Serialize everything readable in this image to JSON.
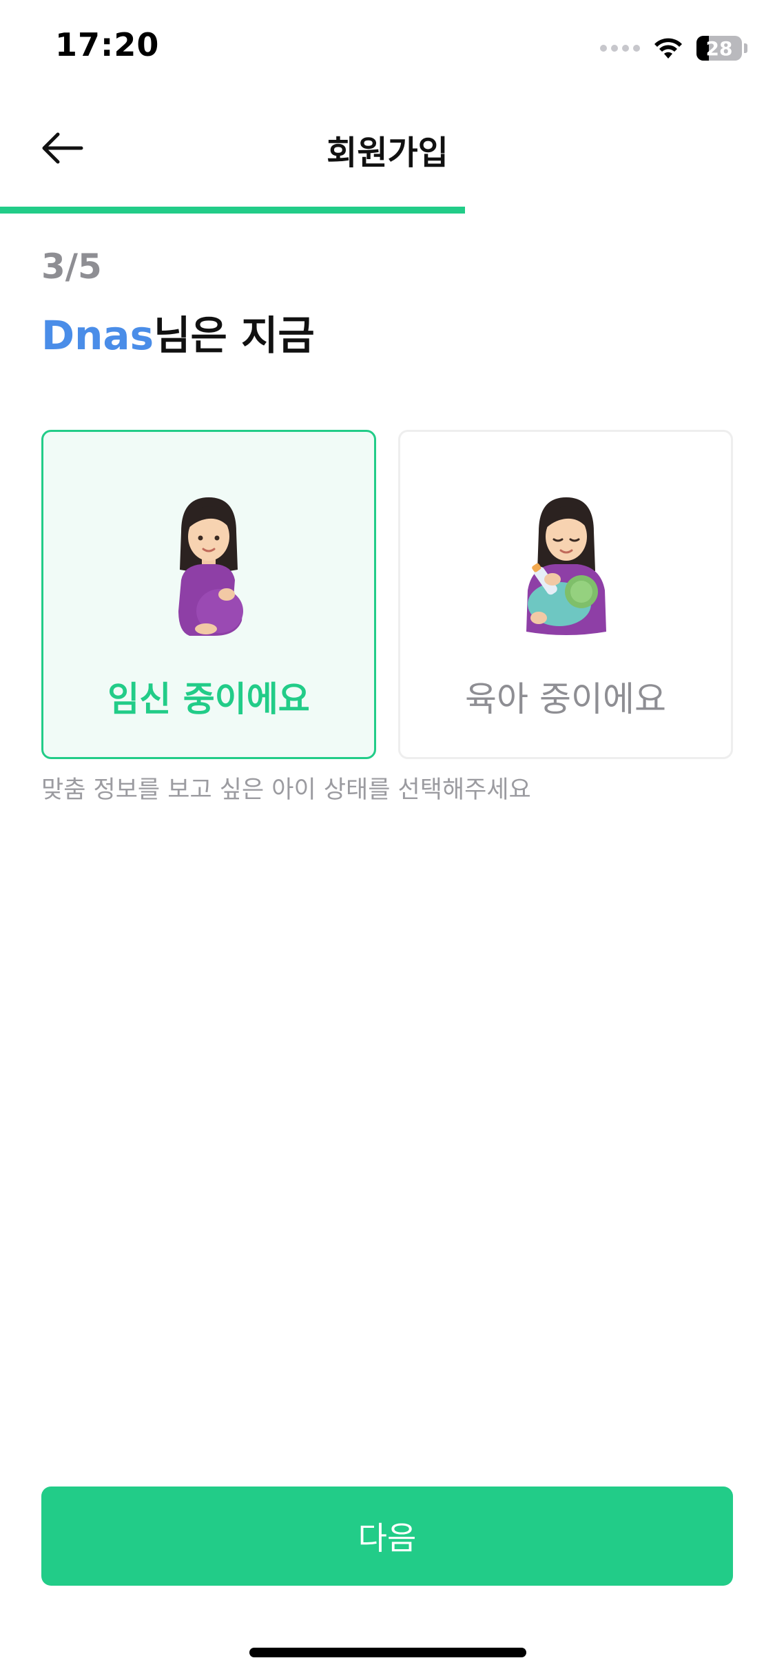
{
  "status_bar": {
    "time": "17:20",
    "battery_level": "28"
  },
  "header": {
    "title": "회원가입",
    "back_icon": "arrow-left-icon"
  },
  "progress": {
    "current": 3,
    "total": 5,
    "fraction": 0.6,
    "accent": "#22cc88"
  },
  "step": {
    "label": "3/5"
  },
  "heading": {
    "name": "Dnas",
    "suffix": "님은 지금",
    "name_color": "#4a8de8"
  },
  "options": [
    {
      "label": "임신 중이에요",
      "icon": "pregnant-woman-icon",
      "selected": true
    },
    {
      "label": "육아 중이에요",
      "icon": "breastfeeding-woman-icon",
      "selected": false
    }
  ],
  "hint": "맞춤 정보를 보고 싶은 아이 상태를 선택해주세요",
  "next_button": {
    "label": "다음"
  }
}
